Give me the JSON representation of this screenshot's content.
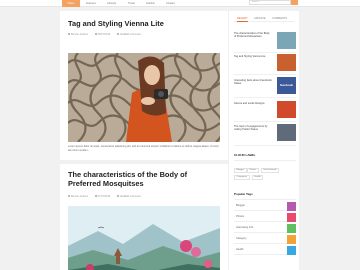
{
  "nav": {
    "home": "Home",
    "items": [
      "Features",
      "Lifestyle",
      "Travel",
      "Fashion",
      "Contact"
    ],
    "search_placeholder": "Search..."
  },
  "posts": [
    {
      "title": "Tag and Styling Vienna Lite",
      "author": "Bonnie Jenkins",
      "date": "09/07/2015",
      "comments": "Add/Edit Comment",
      "excerpt": "Lorem ipsum dolor sit amet, consectetur adipiscing elit, sed do eiusmod tempor incididunt ut labore et dolore magna aliqua. Ut enim ad minim veniam..."
    },
    {
      "title": "The characteristics of the Body of Preferred Mosquitses",
      "author": "Bonnie Jenkins",
      "date": "07/07/2015",
      "comments": "Add/Edit Comment"
    }
  ],
  "sidebar": {
    "tabs": [
      "RECENT",
      "ARCHIVE",
      "COMMENTS"
    ],
    "recent": [
      {
        "title": "The characteristics of the Body of Preferred Mosquitses",
        "thumb": "#7aa6b5"
      },
      {
        "title": "Tag and Styling Vienna Lite",
        "thumb": "#c8612f"
      },
      {
        "title": "Interesting facts about Facebook Status",
        "thumb": "#3b5998",
        "thumb_text": "facebook"
      },
      {
        "title": "Gloves and socks Designs",
        "thumb": "#d24a2c"
      },
      {
        "title": "The topic of engagements by writing Twitter Status",
        "thumb": "#5f6b7a"
      }
    ],
    "labels_title": "CLOUD LABEL",
    "labels": [
      "Blogger",
      "Photos",
      "Hot Featured",
      "Categories",
      "Health"
    ],
    "popular_title": "Popular Tags",
    "popular": [
      {
        "name": "Blogger",
        "color": "#b65ab0"
      },
      {
        "name": "Photos",
        "color": "#e84b6f"
      },
      {
        "name": "Interesting Info",
        "color": "#5ec05e"
      },
      {
        "name": "Category",
        "color": "#f2a23a"
      },
      {
        "name": "Health",
        "color": "#3aa8e0"
      }
    ]
  }
}
